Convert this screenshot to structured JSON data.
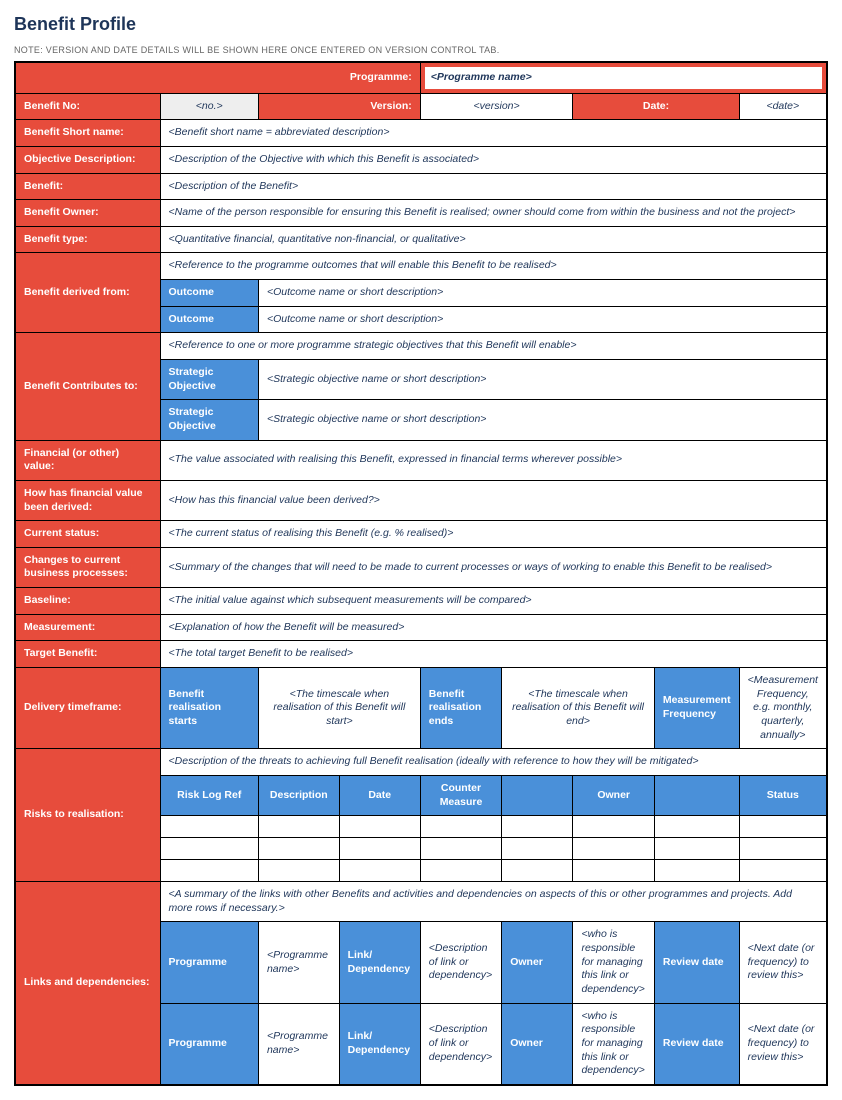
{
  "title": "Benefit Profile",
  "note": "NOTE: VERSION AND DATE DETAILS WILL BE SHOWN HERE ONCE ENTERED ON VERSION CONTROL TAB.",
  "header": {
    "programme_label": "Programme:",
    "programme_value": "<Programme name>",
    "benefit_no_label": "Benefit No:",
    "benefit_no_value": "<no.>",
    "version_label": "Version:",
    "version_value": "<version>",
    "date_label": "Date:",
    "date_value": "<date>"
  },
  "rows": {
    "short_name_label": "Benefit Short name:",
    "short_name_value": "<Benefit short name = abbreviated description>",
    "objective_label": "Objective Description:",
    "objective_value": "<Description of the Objective with which this Benefit is associated>",
    "benefit_label": "Benefit:",
    "benefit_value": "<Description of the Benefit>",
    "owner_label": "Benefit Owner:",
    "owner_value": "<Name of the person responsible for ensuring this Benefit is realised; owner should come from within the business and not the project>",
    "type_label": "Benefit type:",
    "type_value": "<Quantitative financial, quantitative non-financial, or qualitative>",
    "derived_label": "Benefit derived from:",
    "derived_intro": "<Reference to the programme outcomes that will enable this Benefit to be realised>",
    "outcome_label": "Outcome",
    "outcome_value": "<Outcome name or short description>",
    "contributes_label": "Benefit Contributes to:",
    "contributes_intro": "<Reference to one or more programme strategic objectives that this Benefit will enable>",
    "strategic_label": "Strategic Objective",
    "strategic_value": "<Strategic objective name or short description>",
    "financial_label": "Financial (or other) value:",
    "financial_value": "<The value associated with realising this Benefit, expressed in financial terms wherever possible>",
    "how_derived_label": "How has financial value been derived:",
    "how_derived_value": "<How has this financial value been derived?>",
    "status_label": "Current status:",
    "status_value": "<The current status of realising this Benefit (e.g. % realised)>",
    "changes_label": "Changes to current business processes:",
    "changes_value": "<Summary of the changes that will need to be made to current processes or ways of working to enable this Benefit to be realised>",
    "baseline_label": "Baseline:",
    "baseline_value": "<The initial value against which subsequent measurements will be compared>",
    "measurement_label": "Measurement:",
    "measurement_value": "<Explanation of how the Benefit will be measured>",
    "target_label": "Target Benefit:",
    "target_value": "<The total target Benefit to be realised>"
  },
  "timeframe": {
    "label": "Delivery timeframe:",
    "start_label": "Benefit realisation starts",
    "start_value": "<The timescale when realisation of this Benefit will start>",
    "end_label": "Benefit realisation ends",
    "end_value": "<The timescale when realisation of this Benefit will end>",
    "freq_label": "Measurement Frequency",
    "freq_value": "<Measurement Frequency, e.g. monthly, quarterly, annually>"
  },
  "risks": {
    "label": "Risks to realisation:",
    "intro": "<Description of the threats to achieving full Benefit realisation (ideally with reference to how they will be mitigated>",
    "h_ref": "Risk Log Ref",
    "h_desc": "Description",
    "h_date": "Date",
    "h_counter": "Counter Measure",
    "h_owner": "Owner",
    "h_status": "Status"
  },
  "links": {
    "label": "Links and dependencies:",
    "intro": "<A summary of the links with other Benefits and activities and dependencies on aspects of this or other programmes and projects.  Add more rows if necessary.>",
    "prog_label": "Programme",
    "prog_value": "<Programme name>",
    "link_label": "Link/ Dependency",
    "link_value": "<Description of link or dependency>",
    "owner_label": "Owner",
    "owner_value": "<who is responsible for managing this link or dependency>",
    "review_label": "Review date",
    "review_value": "<Next date (or frequency) to review this>"
  }
}
